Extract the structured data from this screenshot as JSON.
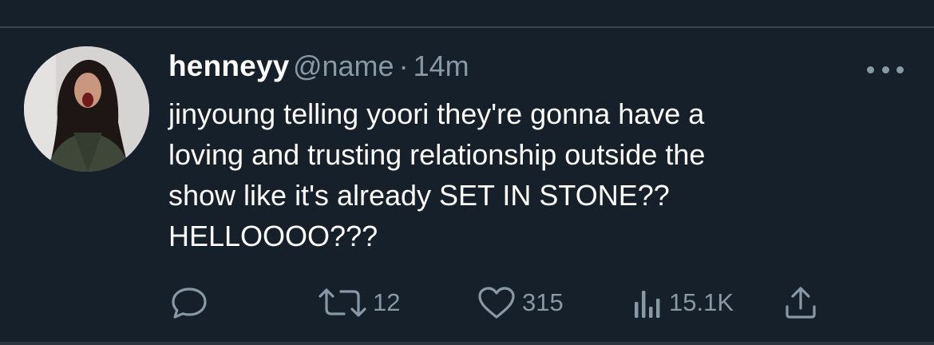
{
  "tweet": {
    "display_name": "henneyy",
    "handle": "@name",
    "separator": "·",
    "timestamp": "14m",
    "text_lines": [
      "jinyoung telling yoori they're gonna have a",
      "loving and trusting relationship outside the",
      "show like it's already SET IN STONE??",
      "HELLOOOO???"
    ],
    "actions": {
      "reply_icon": "reply-icon",
      "retweet_icon": "retweet-icon",
      "retweet_count": "12",
      "like_icon": "heart-icon",
      "like_count": "315",
      "views_icon": "analytics-icon",
      "views_count": "15.1K",
      "share_icon": "share-icon"
    },
    "more_icon": "more-icon"
  },
  "theme": {
    "background": "#15202b",
    "text_primary": "#ffffff",
    "text_secondary": "#8899a6",
    "divider": "#38444d"
  }
}
